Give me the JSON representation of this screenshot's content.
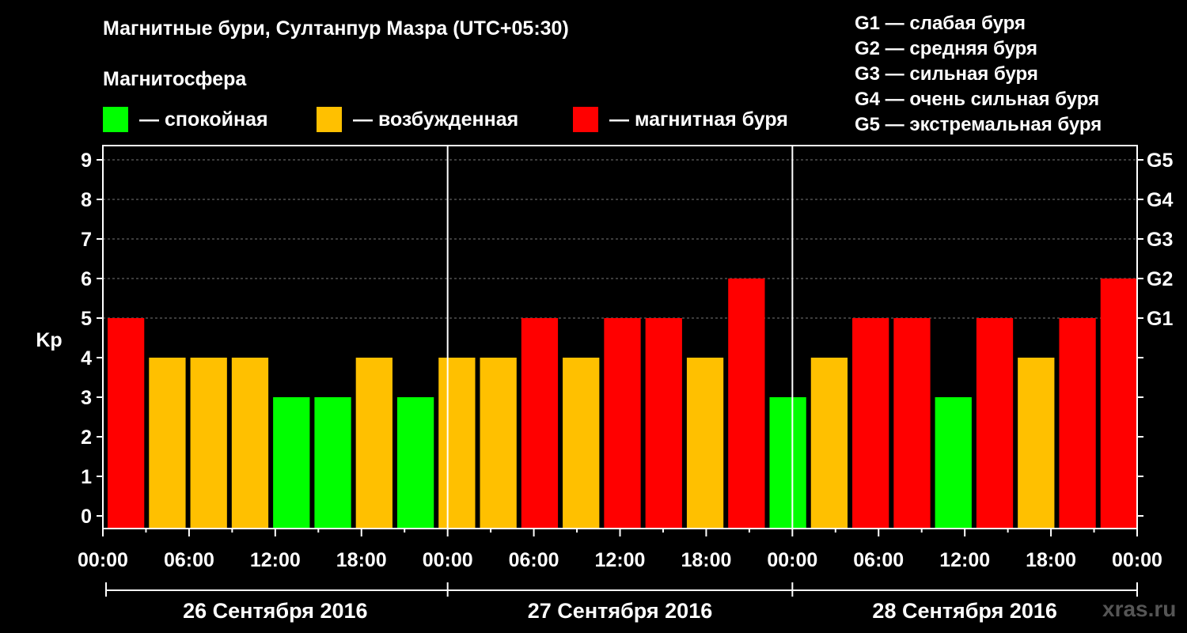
{
  "header": {
    "title": "Магнитные бури, Султанпур Мазра (UTC+05:30)",
    "subtitle": "Магнитосфера"
  },
  "legend": [
    {
      "label": "— спокойная",
      "color": "#00ff00"
    },
    {
      "label": "— возбужденная",
      "color": "#ffc000"
    },
    {
      "label": "— магнитная буря",
      "color": "#ff0000"
    }
  ],
  "storm_scale": [
    "G1 — слабая буря",
    "G2 — средняя буря",
    "G3 — сильная буря",
    "G4 — очень сильная буря",
    "G5 — экстремальная буря"
  ],
  "watermark": "xras.ru",
  "chart_data": {
    "type": "bar",
    "ylabel": "Kp",
    "ylim": [
      0,
      9
    ],
    "yticks": [
      "0",
      "1",
      "2",
      "3",
      "4",
      "5",
      "6",
      "7",
      "8",
      "9"
    ],
    "right_ticks": [
      {
        "value": 5,
        "label": "G1"
      },
      {
        "value": 6,
        "label": "G2"
      },
      {
        "value": 7,
        "label": "G3"
      },
      {
        "value": 8,
        "label": "G4"
      },
      {
        "value": 9,
        "label": "G5"
      }
    ],
    "xticks": [
      "00:00",
      "06:00",
      "12:00",
      "18:00",
      "00:00",
      "06:00",
      "12:00",
      "18:00",
      "00:00",
      "06:00",
      "12:00",
      "18:00",
      "00:00"
    ],
    "days": [
      "26 Сентября 2016",
      "27 Сентября 2016",
      "28 Сентября 2016"
    ],
    "interval_hours": 3,
    "values": [
      5,
      4,
      4,
      4,
      3,
      3,
      4,
      3,
      4,
      4,
      5,
      4,
      5,
      5,
      4,
      6,
      3,
      4,
      5,
      5,
      3,
      5,
      4,
      5,
      6
    ],
    "color_thresholds": {
      "quiet_max": 3,
      "active_max": 4
    },
    "colors": {
      "quiet": "#00ff00",
      "active": "#ffc000",
      "storm": "#ff0000"
    },
    "grid": true
  }
}
